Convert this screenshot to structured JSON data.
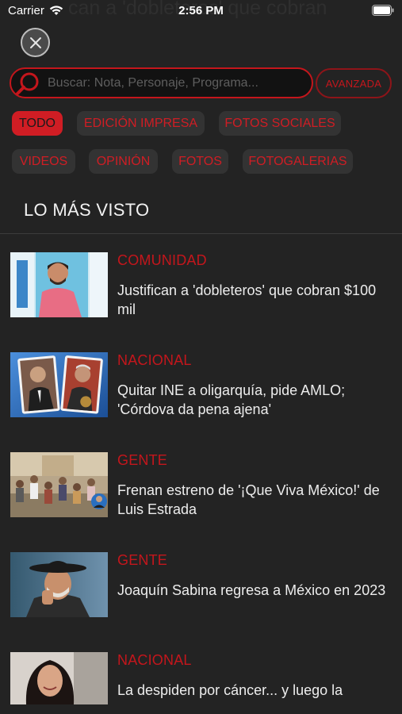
{
  "status": {
    "carrier": "Carrier",
    "time": "2:56 PM"
  },
  "ghost_title": "can a 'dobleteros' que cobran",
  "search": {
    "placeholder": "Buscar: Nota, Personaje, Programa...",
    "advanced_label": "AVANZADA"
  },
  "filters": [
    {
      "label": "TODO",
      "active": true
    },
    {
      "label": "EDICIÓN IMPRESA",
      "active": false
    },
    {
      "label": "FOTOS SOCIALES",
      "active": false
    },
    {
      "label": "VIDEOS",
      "active": false
    },
    {
      "label": "OPINIÓN",
      "active": false
    },
    {
      "label": "FOTOS",
      "active": false
    },
    {
      "label": "FOTOGALERIAS",
      "active": false
    }
  ],
  "section_title": "LO MÁS VISTO",
  "articles": [
    {
      "category": "COMUNIDAD",
      "headline": "Justifican a 'dobleteros' que cobran $100 mil"
    },
    {
      "category": "NACIONAL",
      "headline": "Quitar INE a oligarquía, pide AMLO; 'Córdova da pena ajena'"
    },
    {
      "category": "GENTE",
      "headline": "Frenan estreno de '¡Que Viva México!' de Luis Estrada"
    },
    {
      "category": "GENTE",
      "headline": "Joaquín Sabina regresa a México en 2023"
    },
    {
      "category": "NACIONAL",
      "headline": "La despiden por cáncer... y luego la"
    }
  ],
  "colors": {
    "accent": "#c4161c",
    "background": "#232323",
    "chip": "#333333"
  }
}
